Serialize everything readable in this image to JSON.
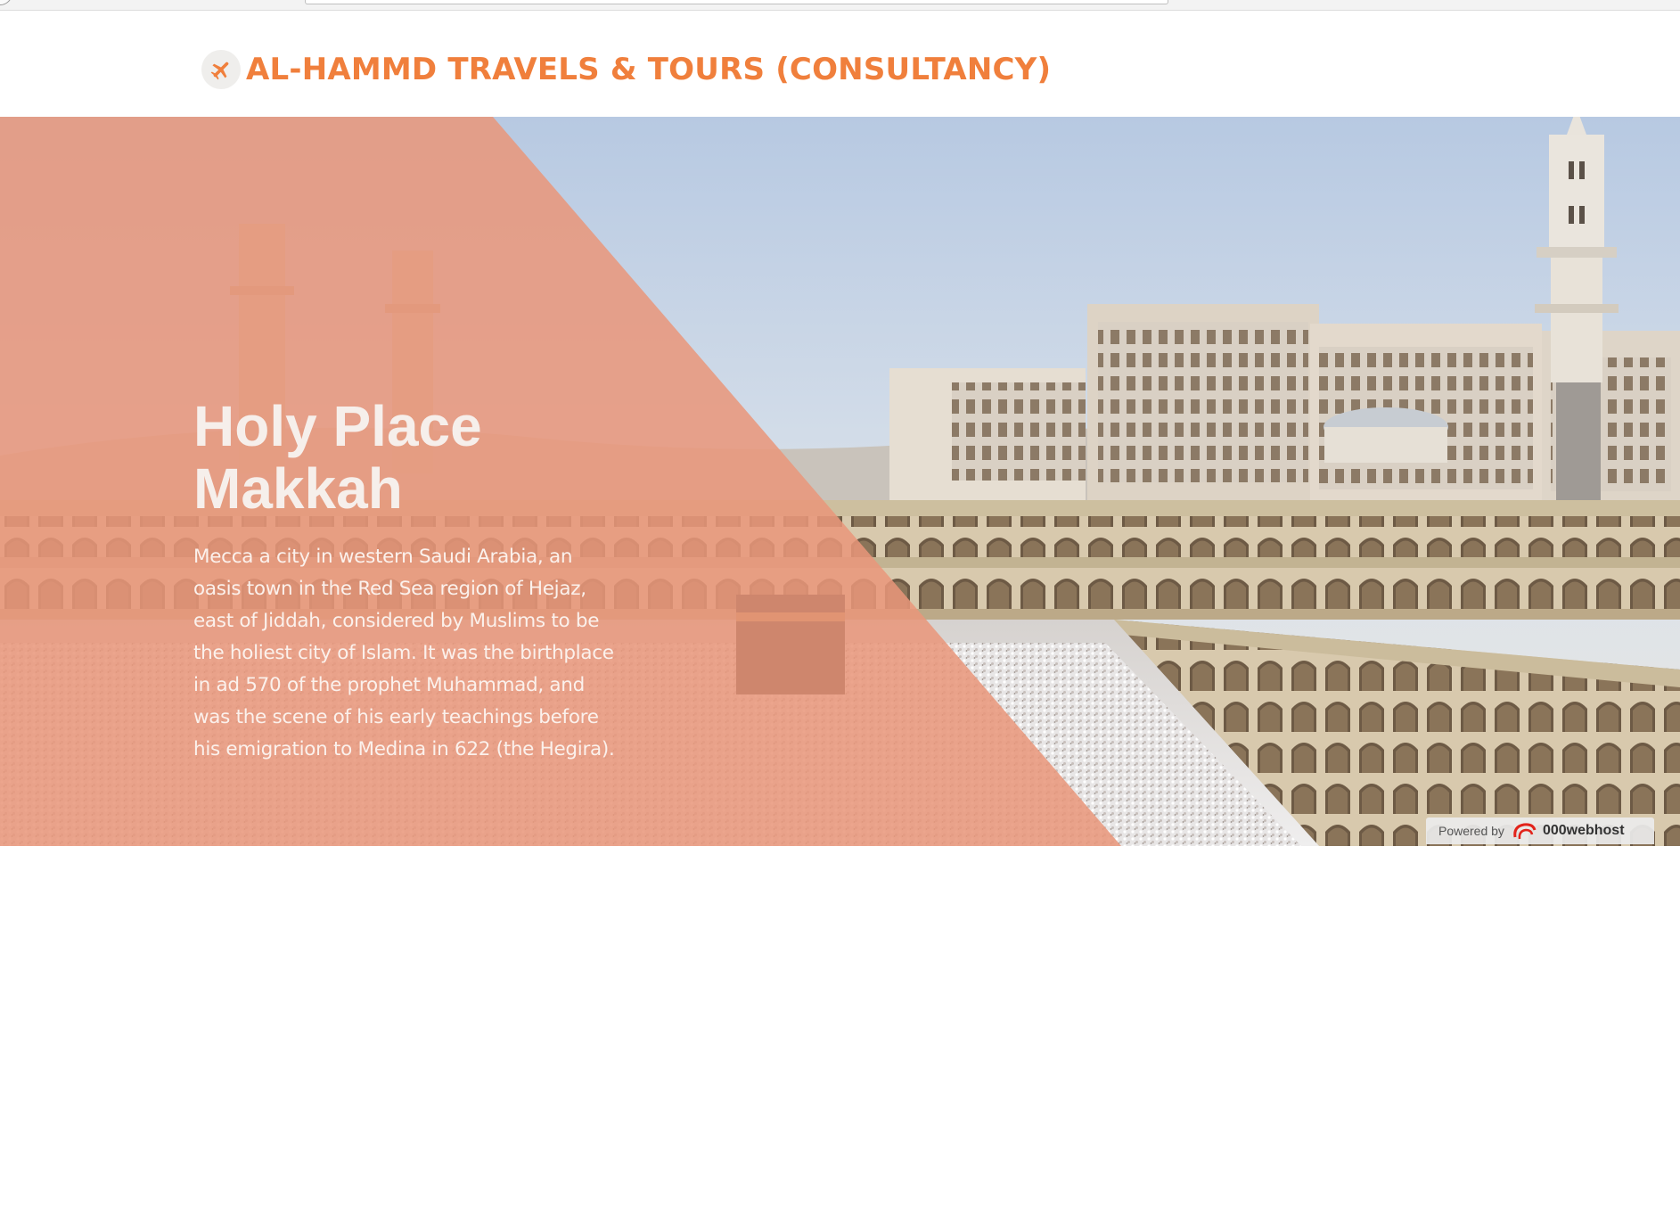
{
  "header": {
    "brand_title": "AL-HAMMD TRAVELS & TOURS (CONSULTANCY)",
    "brand_icon": "airplane-icon"
  },
  "hero": {
    "heading_line1": "Holy Place",
    "heading_line2": "Makkah",
    "description": "Mecca a city in western Saudi Arabia, an oasis town in the Red Sea region of Hejaz, east of Jiddah, considered by Muslims to be the holiest city of Islam. It was the birthplace in ad 570 of the prophet Muhammad, and was the scene of his early teachings before his emigration to Medina in 622 (the Hegira).",
    "overlay_color": "#e9967a"
  },
  "footer_badge": {
    "powered_label": "Powered by",
    "host_name": "000webhost"
  },
  "colors": {
    "brand": "#f07f3c",
    "overlay": "#e99a80"
  }
}
